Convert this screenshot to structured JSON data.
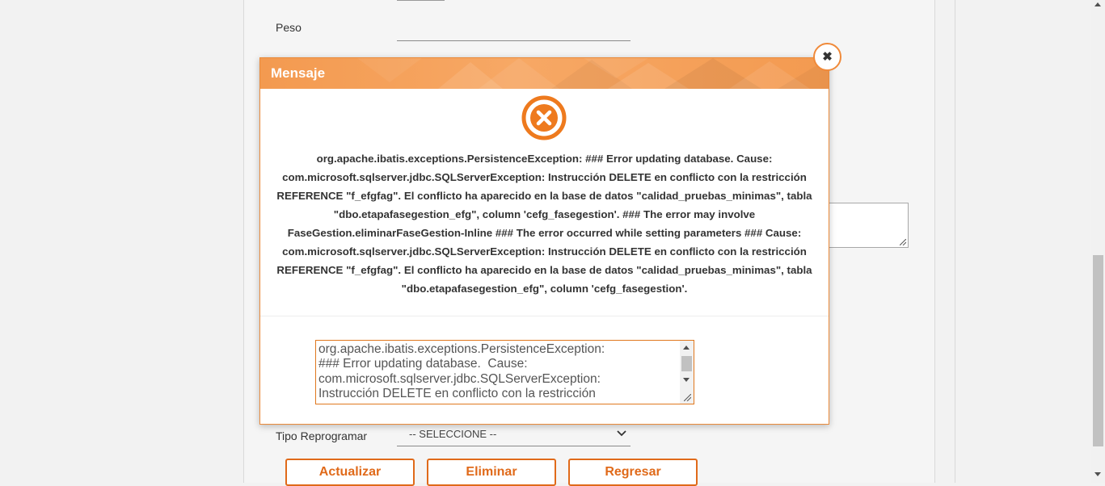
{
  "form": {
    "peso_label": "Peso",
    "tipo_reprogramar_label": "Tipo Reprogramar",
    "tipo_reprogramar_value": "-- SELECCIONE --",
    "buttons": {
      "actualizar": "Actualizar",
      "eliminar": "Eliminar",
      "regresar": "Regresar"
    }
  },
  "modal": {
    "title": "Mensaje",
    "close_symbol": "✖",
    "icon": "error-x-circle-icon",
    "message": "org.apache.ibatis.exceptions.PersistenceException: ### Error updating database. Cause: com.microsoft.sqlserver.jdbc.SQLServerException: Instrucción DELETE en conflicto con la restricción REFERENCE \"f_efgfag\". El conflicto ha aparecido en la base de datos \"calidad_pruebas_minimas\", tabla \"dbo.etapafasegestion_efg\", column 'cefg_fasegestion'. ### The error may involve FaseGestion.eliminarFaseGestion-Inline ### The error occurred while setting parameters ### Cause: com.microsoft.sqlserver.jdbc.SQLServerException: Instrucción DELETE en conflicto con la restricción REFERENCE \"f_efgfag\". El conflicto ha aparecido en la base de datos \"calidad_pruebas_minimas\", tabla \"dbo.etapafasegestion_efg\", column 'cefg_fasegestion'.",
    "detail_lines": [
      "org.apache.ibatis.exceptions.PersistenceException:",
      "### Error updating database.  Cause:",
      "com.microsoft.sqlserver.jdbc.SQLServerException:",
      "Instrucción DELETE en conflicto con la restricción"
    ]
  },
  "colors": {
    "accent": "#e06a1a",
    "header": "#f39a50"
  }
}
